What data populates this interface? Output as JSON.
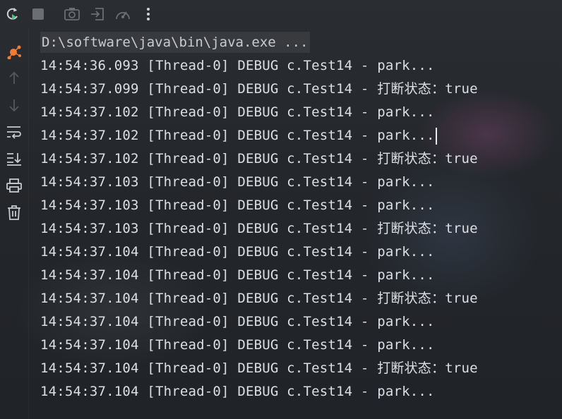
{
  "toolbar": {
    "items": [
      {
        "icon": "rerun-icon",
        "color": "#4cc17a"
      },
      {
        "icon": "stop-icon",
        "color": "#6b6e73"
      },
      {
        "icon": "camera-icon",
        "color": "#6b6e73"
      },
      {
        "icon": "exit-icon",
        "color": "#6b6e73"
      },
      {
        "icon": "gauge-icon",
        "color": "#6b6e73"
      },
      {
        "icon": "more-vertical-icon",
        "color": "#cfd2d6"
      }
    ]
  },
  "sidebar": {
    "items": [
      {
        "icon": "debug-graph-icon",
        "color": "#f37b35"
      },
      {
        "icon": "arrow-up-icon",
        "color": "#55585d"
      },
      {
        "icon": "arrow-down-icon",
        "color": "#55585d"
      },
      {
        "icon": "soft-wrap-icon",
        "color": "#c7cacf"
      },
      {
        "icon": "scroll-to-end-icon",
        "color": "#c7cacf"
      },
      {
        "icon": "print-icon",
        "color": "#c7cacf"
      },
      {
        "icon": "trash-icon",
        "color": "#c7cacf"
      }
    ]
  },
  "console": {
    "command": "D:\\software\\java\\bin\\java.exe ...",
    "lines": [
      "14:54:36.093 [Thread-0] DEBUG c.Test14 - park...",
      "14:54:37.099 [Thread-0] DEBUG c.Test14 - 打断状态：true",
      "14:54:37.102 [Thread-0] DEBUG c.Test14 - park...",
      "14:54:37.102 [Thread-0] DEBUG c.Test14 - park...",
      "14:54:37.102 [Thread-0] DEBUG c.Test14 - 打断状态：true",
      "14:54:37.103 [Thread-0] DEBUG c.Test14 - park...",
      "14:54:37.103 [Thread-0] DEBUG c.Test14 - park...",
      "14:54:37.103 [Thread-0] DEBUG c.Test14 - 打断状态：true",
      "14:54:37.104 [Thread-0] DEBUG c.Test14 - park...",
      "14:54:37.104 [Thread-0] DEBUG c.Test14 - park...",
      "14:54:37.104 [Thread-0] DEBUG c.Test14 - 打断状态：true",
      "14:54:37.104 [Thread-0] DEBUG c.Test14 - park...",
      "14:54:37.104 [Thread-0] DEBUG c.Test14 - park...",
      "14:54:37.104 [Thread-0] DEBUG c.Test14 - 打断状态：true",
      "14:54:37.104 [Thread-0] DEBUG c.Test14 - park..."
    ]
  }
}
